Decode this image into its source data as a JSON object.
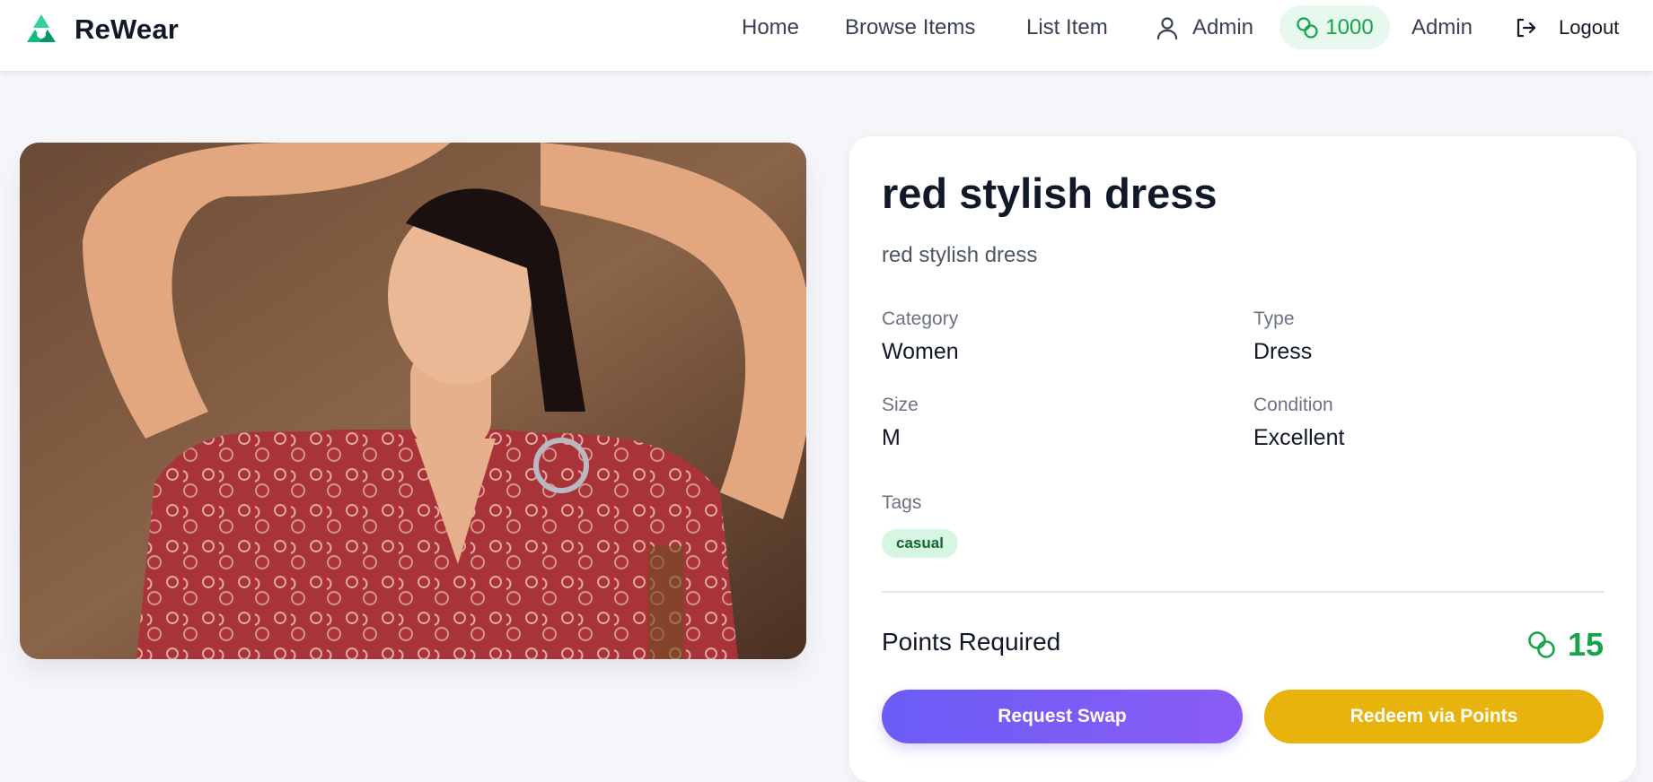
{
  "brand": {
    "name": "ReWear",
    "logo_icon": "recycle-icon"
  },
  "nav": {
    "links": [
      "Home",
      "Browse Items",
      "List Item"
    ],
    "user_label": "Admin",
    "points_balance": "1000",
    "admin_label": "Admin",
    "logout_label": "Logout"
  },
  "item": {
    "title": "red stylish dress",
    "description": "red stylish dress",
    "fields": {
      "category": {
        "label": "Category",
        "value": "Women"
      },
      "type": {
        "label": "Type",
        "value": "Dress"
      },
      "size": {
        "label": "Size",
        "value": "M"
      },
      "condition": {
        "label": "Condition",
        "value": "Excellent"
      }
    },
    "tags_label": "Tags",
    "tags": [
      "casual"
    ],
    "points_label": "Points Required",
    "points_value": "15"
  },
  "actions": {
    "swap_label": "Request Swap",
    "redeem_label": "Redeem via Points"
  },
  "colors": {
    "accent_green": "#16a34a",
    "swap_purple": "#6b5cf6",
    "redeem_yellow": "#e8b30d"
  }
}
